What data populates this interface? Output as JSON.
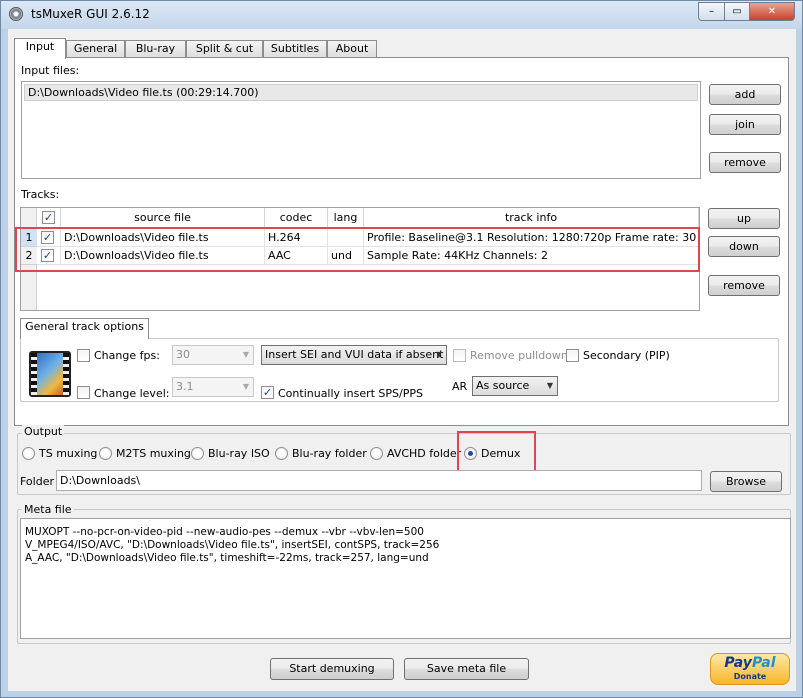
{
  "window": {
    "title": "tsMuxeR GUI 2.6.12",
    "min": "–",
    "max": "▭",
    "close": "✕"
  },
  "tabs": [
    {
      "label": "Input"
    },
    {
      "label": "General"
    },
    {
      "label": "Blu-ray"
    },
    {
      "label": "Split & cut"
    },
    {
      "label": "Subtitles"
    },
    {
      "label": "About"
    }
  ],
  "input": {
    "label": "Input files:",
    "files": [
      "D:\\Downloads\\Video file.ts (00:29:14.700)"
    ],
    "add": "add",
    "join": "join",
    "remove": "remove"
  },
  "tracks": {
    "label": "Tracks:",
    "headers": {
      "source": "source file",
      "codec": "codec",
      "lang": "lang",
      "info": "track info"
    },
    "rows": [
      {
        "num": "1",
        "checked": true,
        "source": "D:\\Downloads\\Video file.ts",
        "codec": "H.264",
        "lang": "",
        "info": "Profile: Baseline@3.1  Resolution: 1280:720p  Frame rate: 30"
      },
      {
        "num": "2",
        "checked": true,
        "source": "D:\\Downloads\\Video file.ts",
        "codec": "AAC",
        "lang": "und",
        "info": "Sample Rate: 44KHz  Channels: 2"
      }
    ],
    "up": "up",
    "down": "down",
    "remove": "remove"
  },
  "track_options": {
    "tab": "General track options",
    "change_fps": "Change fps:",
    "fps_value": "30",
    "sei": "Insert SEI and VUI data if absent",
    "remove_pulldown": "Remove pulldown",
    "secondary": "Secondary (PIP)",
    "change_level": "Change level:",
    "level_value": "3.1",
    "sps_pps": "Continually insert SPS/PPS",
    "ar_label": "AR",
    "ar_value": "As source"
  },
  "output": {
    "label": "Output",
    "options": [
      "TS muxing",
      "M2TS muxing",
      "Blu-ray ISO",
      "Blu-ray folder",
      "AVCHD folder",
      "Demux"
    ],
    "selected": "Demux",
    "folder_label": "Folder",
    "folder_value": "D:\\Downloads\\",
    "browse": "Browse"
  },
  "meta": {
    "label": "Meta file",
    "lines": [
      "MUXOPT --no-pcr-on-video-pid --new-audio-pes --demux --vbr  --vbv-len=500",
      "V_MPEG4/ISO/AVC, \"D:\\Downloads\\Video file.ts\", insertSEI, contSPS, track=256",
      "A_AAC, \"D:\\Downloads\\Video file.ts\", timeshift=-22ms, track=257, lang=und"
    ]
  },
  "footer": {
    "start": "Start demuxing",
    "save": "Save meta file",
    "paypal_pay": "Pay",
    "paypal_pal": "Pal",
    "paypal_donate": "Donate"
  },
  "colors": {
    "highlight": "#e0474c"
  }
}
